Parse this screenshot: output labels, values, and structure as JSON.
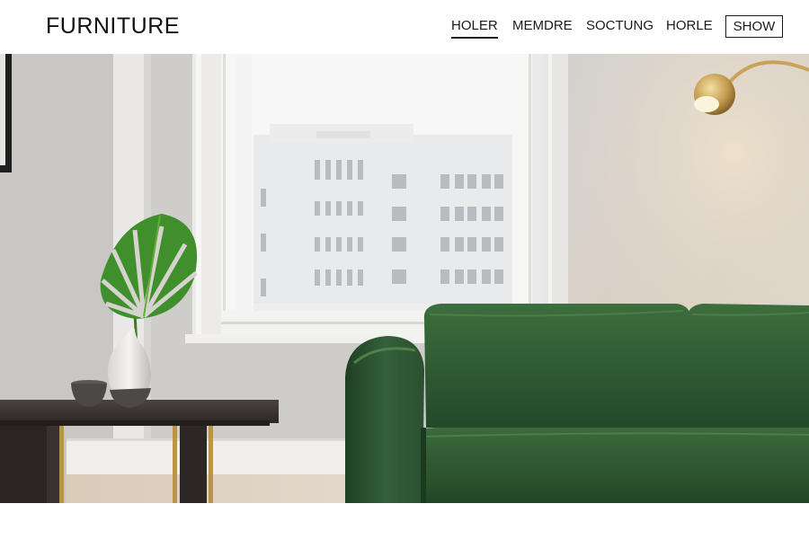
{
  "header": {
    "brand": "FURNITURE",
    "nav": [
      {
        "label": "HOLER",
        "active": true
      },
      {
        "label": "MEMDRE",
        "active": false
      },
      {
        "label": "SOCTUNG",
        "active": false
      },
      {
        "label": "HORLE",
        "active": false
      }
    ],
    "cta_label": "SHOW"
  },
  "hero": {
    "scene": "living-room-photo",
    "colors": {
      "wall": "#d6d3cf",
      "sofa": "#2e5a31",
      "table": "#3b3532",
      "leaf": "#3f8f2c",
      "lamp": "#c9a35a"
    }
  }
}
